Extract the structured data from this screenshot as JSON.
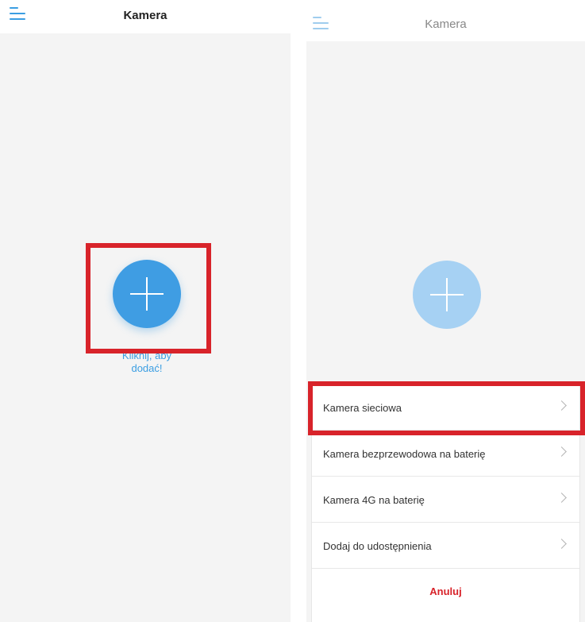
{
  "left_screen": {
    "title": "Kamera",
    "add_hint_line1": "Kliknij, aby",
    "add_hint_line2": "dodać!"
  },
  "right_screen": {
    "title": "Kamera",
    "menu": {
      "items": [
        {
          "label": "Kamera sieciowa"
        },
        {
          "label": "Kamera bezprzewodowa na baterię"
        },
        {
          "label": "Kamera 4G na baterię"
        },
        {
          "label": "Dodaj do udostępnienia"
        }
      ],
      "cancel_label": "Anuluj"
    }
  },
  "colors": {
    "accent": "#3f9de3",
    "accent_faded": "#a6d1f3",
    "highlight": "#d8232a",
    "background": "#f4f4f4"
  },
  "icons": {
    "menu": "hamburger-menu-icon",
    "add": "plus-icon",
    "chevron": "chevron-right-icon"
  }
}
